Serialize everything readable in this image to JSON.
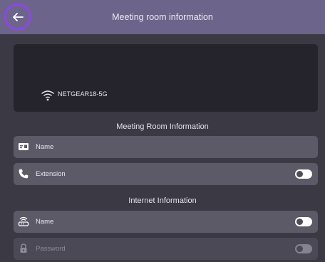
{
  "header": {
    "title": "Meeting room information",
    "back_icon": "arrow-left-icon"
  },
  "preview": {
    "ssid": "NETGEAR18-5G",
    "wifi_icon": "wifi-icon"
  },
  "meeting_section": {
    "title": "Meeting Room Information",
    "rows": [
      {
        "label": "Name",
        "icon": "id-card-icon"
      },
      {
        "label": "Extension",
        "icon": "phone-icon",
        "toggle_on": false
      }
    ]
  },
  "internet_section": {
    "title": "Internet Information",
    "rows": [
      {
        "label": "Name",
        "icon": "router-icon",
        "toggle_on": false
      },
      {
        "label": "Password",
        "icon": "lock-icon",
        "toggle_on": false,
        "disabled": true
      }
    ]
  },
  "colors": {
    "accent": "#8e47e6",
    "header_bg": "#6c648a",
    "page_bg": "#3b3a44",
    "row_bg": "#5b5a66",
    "preview_bg": "#25242c"
  }
}
